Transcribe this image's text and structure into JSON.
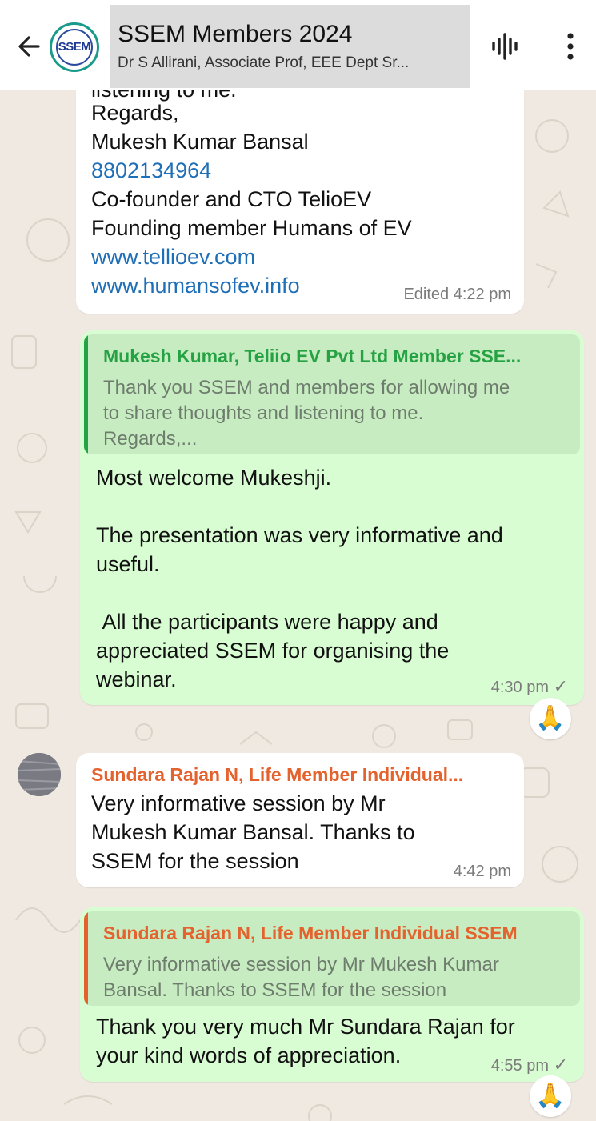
{
  "header": {
    "title": "SSEM Members 2024",
    "subtitle": "Dr S Allirani, Associate Prof, EEE Dept Sr...",
    "logo_text": "SSEM",
    "back_icon": "arrow-left-icon",
    "voice_icon": "audio-wave-icon",
    "menu_icon": "more-vertical-icon"
  },
  "messages": {
    "m1": {
      "cut_line": "listening to me.",
      "regards": "Regards,",
      "name": "Mukesh Kumar Bansal",
      "phone": "8802134964",
      "role1": "Co-founder and CTO TelioEV",
      "role2": "Founding member Humans of EV",
      "link1": "www.tellioev.com",
      "link2": "www.humansofev.info",
      "meta": "Edited 4:22 pm"
    },
    "m2": {
      "quote_name": "Mukesh Kumar, Teliio EV Pvt Ltd Member SSE...",
      "quote_line1": "Thank you SSEM and members for allowing me",
      "quote_line2": "to share thoughts and listening to me.",
      "quote_line3": "Regards,...",
      "p1": "Most welcome Mukeshji.",
      "p2a": "The presentation was very informative and",
      "p2b": "useful.",
      "p3a": " All the participants were happy and",
      "p3b": "appreciated SSEM for organising the",
      "p3c": "webinar.",
      "time": "4:30 pm",
      "tick": "✓",
      "reaction": "🙏"
    },
    "m3": {
      "sender": "Sundara Rajan N, Life Member Individual...",
      "line1": "Very informative session by Mr",
      "line2": "Mukesh Kumar Bansal. Thanks to",
      "line3": "SSEM for the session",
      "time": "4:42 pm"
    },
    "m4": {
      "quote_name": "Sundara Rajan N, Life Member Individual SSEM",
      "quote_line1": "Very informative session by Mr Mukesh Kumar",
      "quote_line2": "Bansal. Thanks to SSEM for the session",
      "line1": "Thank you very much Mr Sundara Rajan for",
      "line2": "your kind words of appreciation.",
      "time": "4:55 pm",
      "tick": "✓",
      "reaction": "🙏"
    }
  },
  "colors": {
    "outgoing_bubble": "#d9fdd3",
    "incoming_bubble": "#ffffff",
    "quote_green": "#25a244",
    "quote_orange": "#e4622d",
    "link": "#1f6fb8"
  }
}
